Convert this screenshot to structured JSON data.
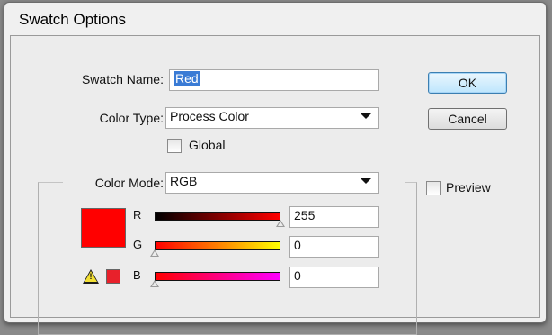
{
  "dialog": {
    "title": "Swatch Options",
    "swatch_name": {
      "label": "Swatch Name:",
      "value": "Red"
    },
    "color_type": {
      "label": "Color Type:",
      "value": "Process Color"
    },
    "global": {
      "label": "Global",
      "checked": false
    },
    "color_mode": {
      "label": "Color Mode:",
      "value": "RGB"
    },
    "color": "#ff0000",
    "channels": [
      {
        "name": "R",
        "value": "255",
        "gradient": [
          "#000000",
          "#ff0000"
        ],
        "level": 1.0
      },
      {
        "name": "G",
        "value": "0",
        "gradient": [
          "#ff0000",
          "#ffff00"
        ],
        "level": 0.0
      },
      {
        "name": "B",
        "value": "0",
        "gradient": [
          "#ff0000",
          "#ff00ff"
        ],
        "level": 0.0
      }
    ],
    "gamut_warning": {
      "icon": "warning-triangle-icon",
      "swatch_color": "#e8212b"
    },
    "buttons": {
      "ok": "OK",
      "cancel": "Cancel"
    },
    "preview": {
      "label": "Preview",
      "checked": false
    }
  }
}
